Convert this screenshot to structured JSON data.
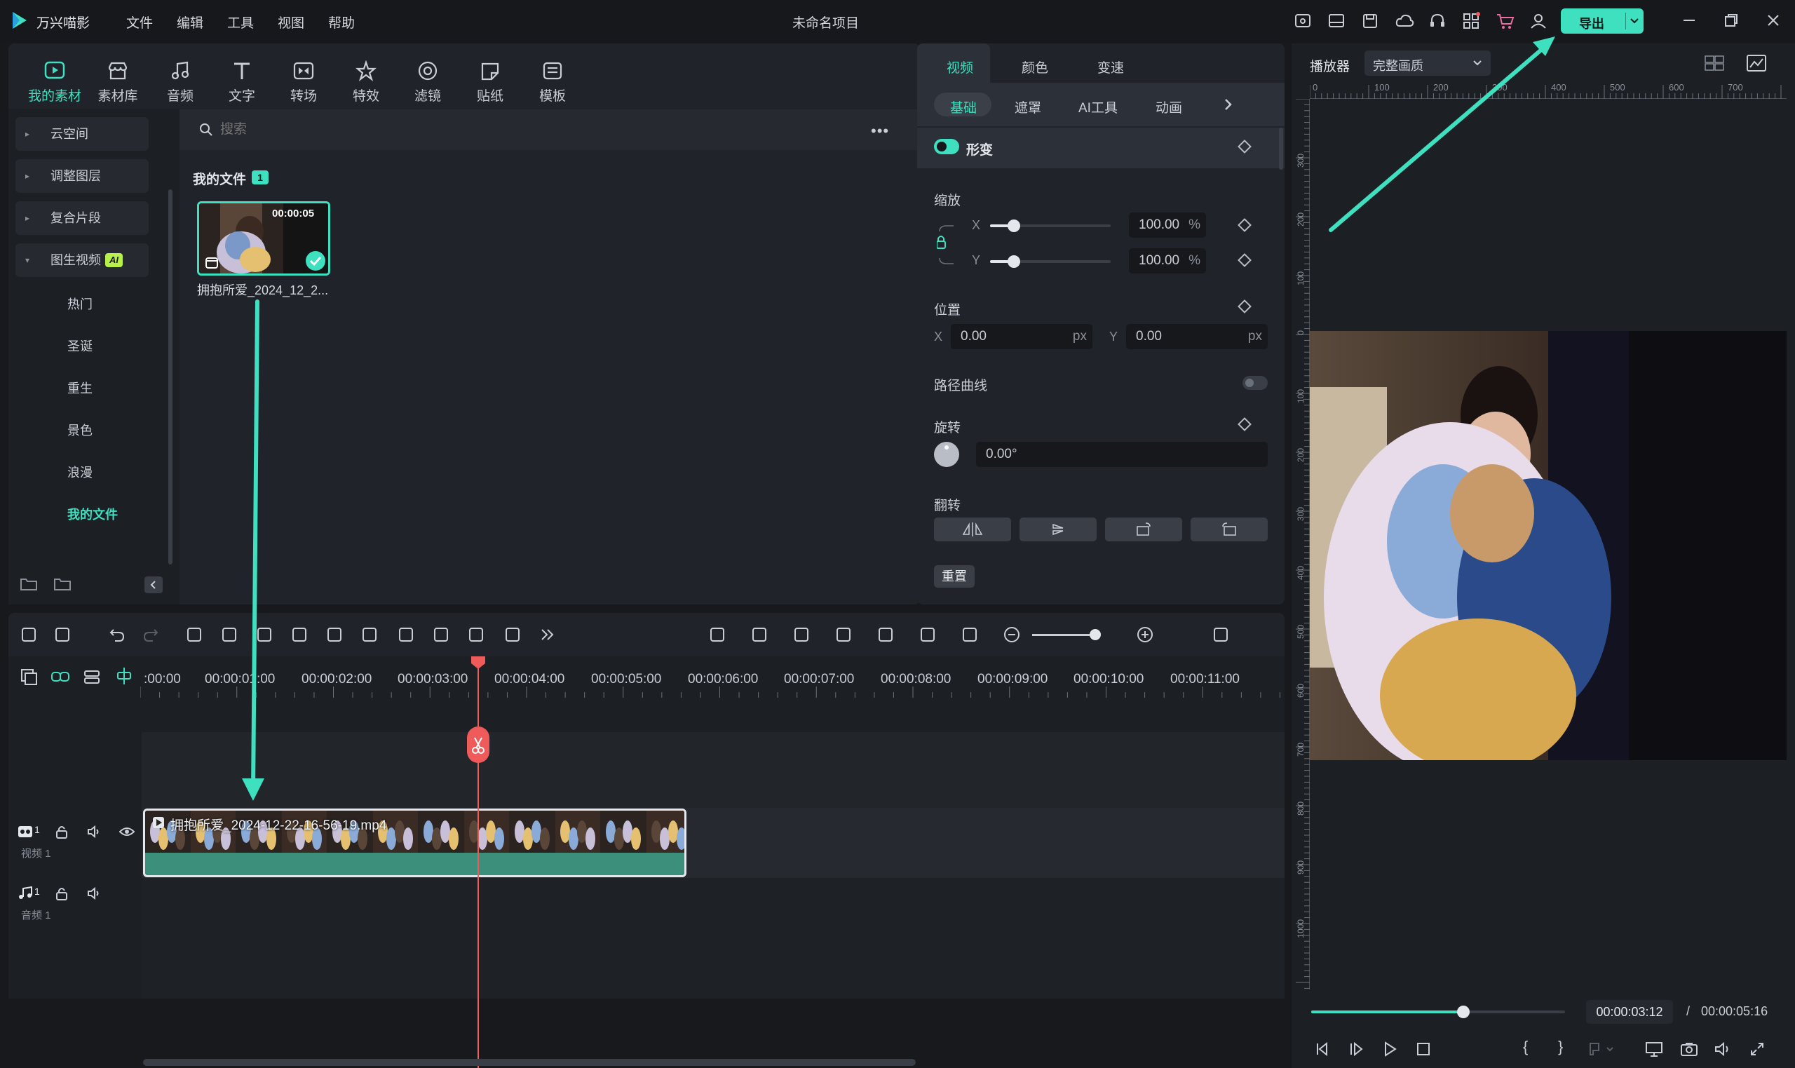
{
  "app": {
    "name": "万兴喵影",
    "project_title": "未命名项目",
    "export_label": "导出"
  },
  "menu": [
    "文件",
    "编辑",
    "工具",
    "视图",
    "帮助"
  ],
  "toolbar": [
    {
      "label": "我的素材",
      "icon": "media-icon",
      "active": true
    },
    {
      "label": "素材库",
      "icon": "store-icon"
    },
    {
      "label": "音频",
      "icon": "music-icon"
    },
    {
      "label": "文字",
      "icon": "text-icon"
    },
    {
      "label": "转场",
      "icon": "transition-icon"
    },
    {
      "label": "特效",
      "icon": "effects-icon"
    },
    {
      "label": "滤镜",
      "icon": "filter-icon"
    },
    {
      "label": "贴纸",
      "icon": "sticker-icon"
    },
    {
      "label": "模板",
      "icon": "template-icon"
    }
  ],
  "sidebar": {
    "items": [
      "云空间",
      "调整图层",
      "复合片段",
      "图生视频"
    ],
    "ai_badge": "AI",
    "subitems": [
      "热门",
      "圣诞",
      "重生",
      "景色",
      "浪漫",
      "我的文件"
    ]
  },
  "media": {
    "search_placeholder": "搜索",
    "section_title": "我的文件",
    "count": "1",
    "clip": {
      "duration": "00:00:05",
      "name": "拥抱所爱_2024_12_2..."
    }
  },
  "inspector": {
    "tabs": [
      "视频",
      "颜色",
      "变速"
    ],
    "subtabs": [
      "基础",
      "遮罩",
      "AI工具",
      "动画"
    ],
    "transform_label": "形变",
    "scale_label": "缩放",
    "x_label": "X",
    "y_label": "Y",
    "scale_x": "100.00",
    "scale_y": "100.00",
    "percent": "%",
    "position_label": "位置",
    "pos_x": "0.00",
    "pos_y": "0.00",
    "px": "px",
    "path_curve_label": "路径曲线",
    "rotate_label": "旋转",
    "rotate_value": "0.00°",
    "flip_label": "翻转",
    "reset_label": "重置",
    "scale_x_level": 0.2,
    "scale_y_level": 0.2
  },
  "player": {
    "label": "播放器",
    "quality": "完整画质",
    "current_time": "00:00:03:12",
    "separator": "/",
    "total_time": "00:00:05:16",
    "progress": 0.6,
    "ruler_h": [
      "0",
      "100",
      "200",
      "300",
      "400",
      "500",
      "600",
      "700"
    ],
    "ruler_v": [
      "300",
      "200",
      "100",
      "0",
      "100",
      "200",
      "300",
      "400",
      "500",
      "600",
      "700",
      "800",
      "900",
      "1000"
    ]
  },
  "timeline": {
    "ticks": [
      ":00:00",
      "00:00:01:00",
      "00:00:02:00",
      "00:00:03:00",
      "00:00:04:00",
      "00:00:05:00",
      "00:00:06:00",
      "00:00:07:00",
      "00:00:08:00",
      "00:00:09:00",
      "00:00:10:00",
      "00:00:11:00"
    ],
    "video_track": {
      "label": "视频 1",
      "num": "1"
    },
    "audio_track": {
      "label": "音频 1",
      "num": "1"
    },
    "clip_name": "拥抱所爱_2024-12-22-16-56-19.mp4"
  },
  "colors": {
    "accent": "#3ee0c0",
    "playhead": "#ef5a5a",
    "panel": "#202329",
    "clip": "#3c8f7a"
  }
}
